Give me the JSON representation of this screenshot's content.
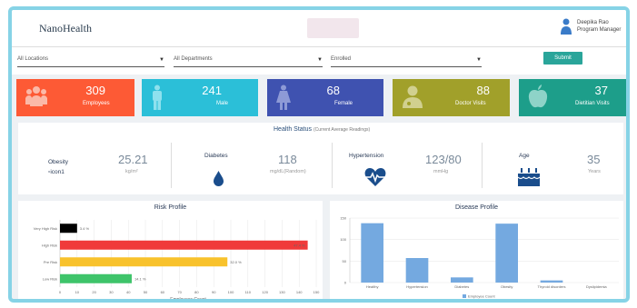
{
  "header": {
    "logo": "NanoHealth",
    "user_name": "Deepika Rao",
    "user_role": "Program Manager"
  },
  "filters": {
    "location": "All Locations",
    "department": "All Departments",
    "status": "Enrolled",
    "submit_label": "Submit"
  },
  "tiles": [
    {
      "value": "309",
      "label": "Employees",
      "color": "#fd5a35",
      "icon": "users-icon"
    },
    {
      "value": "241",
      "label": "Male",
      "color": "#2bbfd8",
      "icon": "male-icon"
    },
    {
      "value": "68",
      "label": "Female",
      "color": "#3f52b0",
      "icon": "female-icon"
    },
    {
      "value": "88",
      "label": "Doctor Visits",
      "color": "#a1a02a",
      "icon": "doctor-icon"
    },
    {
      "value": "37",
      "label": "Dietitian Visits",
      "color": "#1d9e8a",
      "icon": "apple-icon"
    }
  ],
  "health_status": {
    "title": "Health Status",
    "subtitle": "(Current Average Readings)",
    "metrics": [
      {
        "label": "Obesity",
        "value": "25.21",
        "unit": "kg/m²",
        "icon_alt": "icon1"
      },
      {
        "label": "Diabetes",
        "value": "118",
        "unit": "mg/dL(Random)",
        "icon": "drop-icon"
      },
      {
        "label": "Hypertension",
        "value": "123/80",
        "unit": "mmHg",
        "icon": "heartbeat-icon"
      },
      {
        "label": "Age",
        "value": "35",
        "unit": "Years",
        "icon": "birthday-cake-icon"
      }
    ]
  },
  "chart_data": [
    {
      "type": "bar",
      "orientation": "horizontal",
      "title": "Risk Profile",
      "xlabel": "Employees Count",
      "xlim": [
        0,
        150
      ],
      "xticks": [
        "0",
        "10",
        "20",
        "30",
        "40",
        "50",
        "60",
        "70",
        "80",
        "90",
        "100",
        "110",
        "120",
        "130",
        "140",
        "150"
      ],
      "categories": [
        "Very High Risk",
        "High Risk",
        "Pre Risk",
        "Low Risk"
      ],
      "values": [
        10,
        145,
        98,
        42
      ],
      "data_labels": [
        "3.4 %",
        "47.4 %",
        "32.0 %",
        "14.1 %"
      ],
      "colors": [
        "#000000",
        "#f03a3a",
        "#f8c22c",
        "#3ec46a"
      ]
    },
    {
      "type": "bar",
      "title": "Disease Profile",
      "categories": [
        "Healthy",
        "Hypertension",
        "Diabetes",
        "Obesity",
        "Thyroid disorders",
        "Dyslipidemia"
      ],
      "series": [
        {
          "name": "Employee Count",
          "values": [
            138,
            57,
            12,
            137,
            5,
            0
          ]
        }
      ],
      "ylim": [
        0,
        150
      ],
      "yticks": [
        "150",
        "100",
        "50",
        "0"
      ],
      "color": "#74a9e0",
      "legend_position": "bottom"
    }
  ]
}
